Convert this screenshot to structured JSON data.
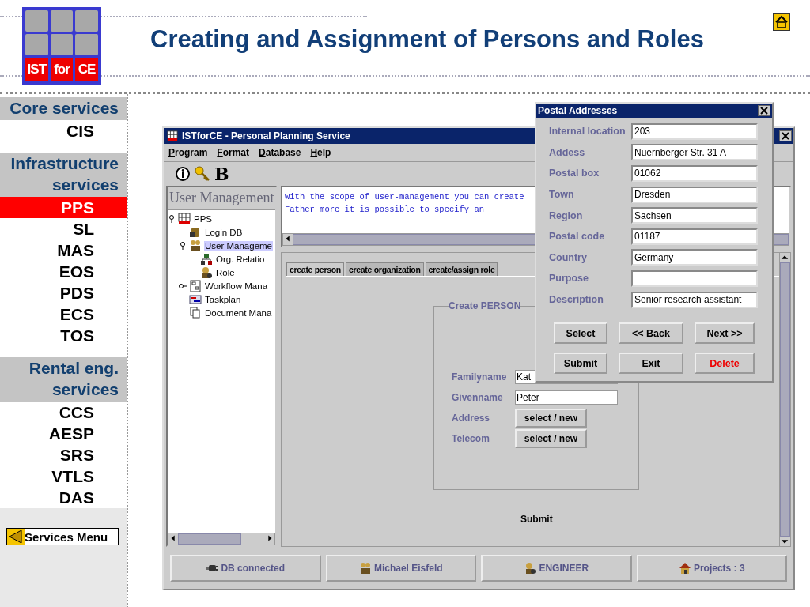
{
  "slide": {
    "title": "Creating and Assignment of Persons and Roles",
    "logo": [
      "IST",
      "for",
      "CE"
    ]
  },
  "nav": {
    "groups": [
      {
        "title": "Core services",
        "items": [
          {
            "label": "CIS",
            "selected": false
          }
        ]
      },
      {
        "title": "Infrastructure services",
        "items": [
          {
            "label": "PPS",
            "selected": true
          },
          {
            "label": "SL",
            "selected": false
          },
          {
            "label": "MAS",
            "selected": false
          },
          {
            "label": "EOS",
            "selected": false
          },
          {
            "label": "PDS",
            "selected": false
          },
          {
            "label": "ECS",
            "selected": false
          },
          {
            "label": "TOS",
            "selected": false
          }
        ]
      },
      {
        "title": "Rental eng. services",
        "items": [
          {
            "label": "CCS",
            "selected": false
          },
          {
            "label": "AESP",
            "selected": false
          },
          {
            "label": "SRS",
            "selected": false
          },
          {
            "label": "VTLS",
            "selected": false
          },
          {
            "label": "DAS",
            "selected": false
          }
        ]
      }
    ],
    "back_button": "Services Menu"
  },
  "app_window": {
    "title": "ISTforCE - Personal Planning Service",
    "menu": [
      "Program",
      "Format",
      "Database",
      "Help"
    ],
    "toolbar": [
      {
        "kind": "info"
      },
      {
        "kind": "key"
      },
      {
        "kind": "glyph",
        "label": "B"
      }
    ],
    "tree": {
      "header": "User Management",
      "items": [
        {
          "label": "PPS",
          "expanded": true,
          "selected": false,
          "children": [
            {
              "label": "Login DB",
              "selected": false
            },
            {
              "label": "User Manageme",
              "expanded": true,
              "selected": true,
              "children": [
                {
                  "label": "Org. Relatio",
                  "selected": false
                },
                {
                  "label": "Role",
                  "selected": false
                }
              ]
            },
            {
              "label": "Workflow Mana",
              "expanded": false,
              "selected": false
            },
            {
              "label": "Taskplan",
              "selected": false
            },
            {
              "label": "Document Mana",
              "selected": false
            }
          ]
        }
      ]
    },
    "info_text": [
      "With the scope of user-management you can create",
      "Father more it is possible to specify an"
    ],
    "tabs": [
      {
        "label": "create person",
        "selected": true
      },
      {
        "label": "create organization",
        "selected": false
      },
      {
        "label": "create/assign role",
        "selected": false
      }
    ],
    "form": {
      "legend": "Create PERSON",
      "rows": [
        {
          "label": "Familyname",
          "kind": "field",
          "value": "Kat"
        },
        {
          "label": "Givenname",
          "kind": "field",
          "value": "Peter"
        },
        {
          "label": "Address",
          "kind": "button",
          "value": "select / new"
        },
        {
          "label": "Telecom",
          "kind": "button",
          "value": "select / new"
        }
      ],
      "submit": "Submit"
    },
    "status_bar": [
      {
        "label": "DB connected"
      },
      {
        "label": "Michael Eisfeld"
      },
      {
        "label": "ENGINEER"
      },
      {
        "label": "Projects : 3"
      }
    ]
  },
  "dialog": {
    "title": "Postal Addresses",
    "fields": [
      {
        "label": "Internal location",
        "value": "203"
      },
      {
        "label": "Addess",
        "value": "Nuernberger Str. 31 A"
      },
      {
        "label": "Postal box",
        "value": "01062"
      },
      {
        "label": "Town",
        "value": "Dresden"
      },
      {
        "label": "Region",
        "value": "Sachsen"
      },
      {
        "label": "Postal code",
        "value": "01187"
      },
      {
        "label": "Country",
        "value": "Germany"
      },
      {
        "label": "Purpose"
      },
      {
        "label": "Description",
        "value": "Senior research assistant"
      }
    ],
    "buttons": [
      {
        "label": "Select",
        "kind": "normal"
      },
      {
        "label": "<< Back",
        "kind": "normal"
      },
      {
        "label": "Next >>",
        "kind": "normal"
      },
      {
        "label": "Submit",
        "kind": "normal"
      },
      {
        "label": "Exit",
        "kind": "normal"
      },
      {
        "label": "Delete",
        "kind": "danger"
      }
    ]
  }
}
